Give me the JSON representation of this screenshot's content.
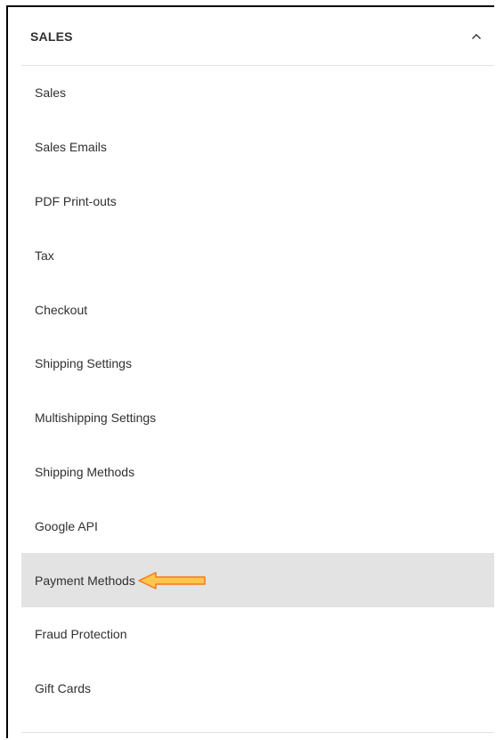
{
  "section": {
    "title": "SALES",
    "expanded": true
  },
  "menu": {
    "items": [
      {
        "label": "Sales"
      },
      {
        "label": "Sales Emails"
      },
      {
        "label": "PDF Print-outs"
      },
      {
        "label": "Tax"
      },
      {
        "label": "Checkout"
      },
      {
        "label": "Shipping Settings"
      },
      {
        "label": "Multishipping Settings"
      },
      {
        "label": "Shipping Methods"
      },
      {
        "label": "Google API"
      },
      {
        "label": "Payment Methods"
      },
      {
        "label": "Fraud Protection"
      },
      {
        "label": "Gift Cards"
      }
    ],
    "active_index": 9
  },
  "annotation": {
    "icon": "arrow-left-icon",
    "fill_color": "#fcc74c",
    "stroke_color": "#f47a1f"
  },
  "colors": {
    "active_bg": "#e3e3e3",
    "text": "#303030"
  }
}
